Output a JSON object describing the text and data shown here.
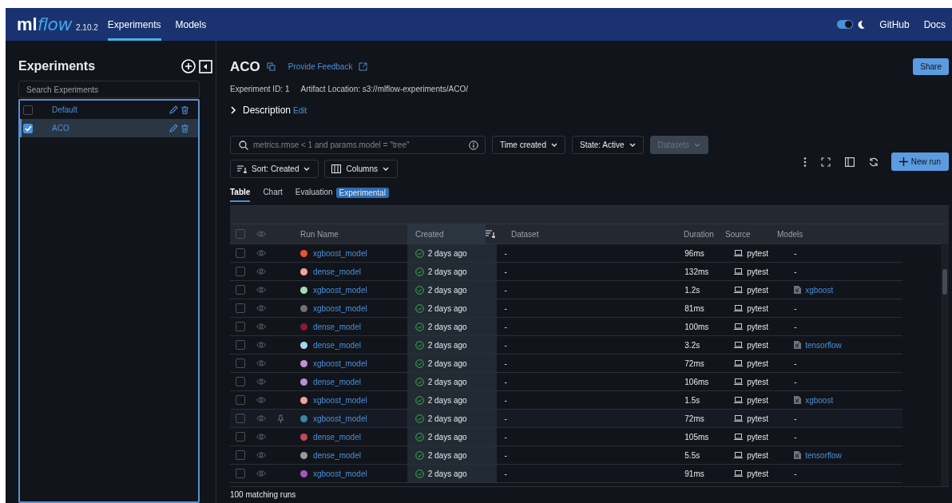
{
  "header": {
    "logo": {
      "part_1": "ml",
      "part_2": "flow"
    },
    "version": "2.10.2",
    "nav": [
      {
        "label": "Experiments",
        "selected": true
      },
      {
        "label": "Models",
        "selected": false
      }
    ],
    "dark_mode": {
      "on": true
    },
    "links": [
      "GitHub",
      "Docs"
    ]
  },
  "sidebar": {
    "title": "Experiments",
    "search": {
      "placeholder": "Search Experiments"
    },
    "items": [
      {
        "name": "Default",
        "checked": false
      },
      {
        "name": "ACO",
        "checked": true
      }
    ]
  },
  "experiment": {
    "title": "ACO",
    "feedback_link": "Provide Feedback",
    "share_button": "Share",
    "experiment_id": "Experiment ID: 1",
    "artifact_location": "Artifact Location: s3://mlflow-experiments/ACO/",
    "description": {
      "label": "Description",
      "edit": "Edit",
      "expanded": false
    }
  },
  "filters": {
    "search": {
      "placeholder": "metrics.rmse < 1 and params.model = \"tree\""
    },
    "dropdowns": [
      {
        "label": "Time created",
        "disabled": false
      },
      {
        "label": "State: Active",
        "disabled": false
      },
      {
        "label": "Datasets",
        "disabled": true
      }
    ],
    "sort": "Sort: Created",
    "columns": "Columns",
    "new_run": "New run"
  },
  "view_tabs": [
    {
      "label": "Table",
      "selected": true
    },
    {
      "label": "Chart",
      "selected": false
    },
    {
      "label": "Evaluation",
      "selected": false,
      "badge": "Experimental"
    }
  ],
  "table": {
    "select_all": {
      "checked": false
    },
    "columns": [
      "Run Name",
      "Created",
      "Dataset",
      "Duration",
      "Source",
      "Models"
    ],
    "rows": [
      {
        "checked": false,
        "pinned": false,
        "color": "#e8532e",
        "name": "xgboost_model",
        "created": "2 days ago",
        "dataset": "-",
        "duration": "96ms",
        "source": "pytest",
        "model": {
          "kind": "none",
          "text": "-"
        }
      },
      {
        "checked": false,
        "pinned": false,
        "color": "#f2a39a",
        "name": "dense_model",
        "created": "2 days ago",
        "dataset": "-",
        "duration": "132ms",
        "source": "pytest",
        "model": {
          "kind": "none",
          "text": "-"
        }
      },
      {
        "checked": false,
        "pinned": false,
        "color": "#a6dbb0",
        "name": "xgboost_model",
        "created": "2 days ago",
        "dataset": "-",
        "duration": "1.2s",
        "source": "pytest",
        "model": {
          "kind": "logged",
          "text": "xgboost"
        }
      },
      {
        "checked": false,
        "pinned": false,
        "color": "#707070",
        "name": "xgboost_model",
        "created": "2 days ago",
        "dataset": "-",
        "duration": "81ms",
        "source": "pytest",
        "model": {
          "kind": "none",
          "text": "-"
        }
      },
      {
        "checked": false,
        "pinned": false,
        "color": "#8b1a3a",
        "name": "dense_model",
        "created": "2 days ago",
        "dataset": "-",
        "duration": "100ms",
        "source": "pytest",
        "model": {
          "kind": "none",
          "text": "-"
        }
      },
      {
        "checked": false,
        "pinned": false,
        "color": "#a6d5ee",
        "name": "dense_model",
        "created": "2 days ago",
        "dataset": "-",
        "duration": "3.2s",
        "source": "pytest",
        "model": {
          "kind": "logged",
          "text": "tensorflow"
        }
      },
      {
        "checked": false,
        "pinned": false,
        "color": "#c38fd8",
        "name": "xgboost_model",
        "created": "2 days ago",
        "dataset": "-",
        "duration": "72ms",
        "source": "pytest",
        "model": {
          "kind": "none",
          "text": "-"
        }
      },
      {
        "checked": false,
        "pinned": false,
        "color": "#b98ed5",
        "name": "dense_model",
        "created": "2 days ago",
        "dataset": "-",
        "duration": "106ms",
        "source": "pytest",
        "model": {
          "kind": "none",
          "text": "-"
        }
      },
      {
        "checked": false,
        "pinned": false,
        "color": "#f2a39a",
        "name": "xgboost_model",
        "created": "2 days ago",
        "dataset": "-",
        "duration": "1.5s",
        "source": "pytest",
        "model": {
          "kind": "logged",
          "text": "xgboost"
        }
      },
      {
        "checked": false,
        "pinned": true,
        "color": "#3a86a8",
        "name": "xgboost_model",
        "created": "2 days ago",
        "dataset": "-",
        "duration": "72ms",
        "source": "pytest",
        "model": {
          "kind": "none",
          "text": "-"
        }
      },
      {
        "checked": false,
        "pinned": false,
        "color": "#c04a5a",
        "name": "dense_model",
        "created": "2 days ago",
        "dataset": "-",
        "duration": "105ms",
        "source": "pytest",
        "model": {
          "kind": "none",
          "text": "-"
        }
      },
      {
        "checked": false,
        "pinned": false,
        "color": "#9a9a9a",
        "name": "dense_model",
        "created": "2 days ago",
        "dataset": "-",
        "duration": "5.5s",
        "source": "pytest",
        "model": {
          "kind": "logged",
          "text": "tensorflow"
        }
      },
      {
        "checked": false,
        "pinned": false,
        "color": "#a855c0",
        "name": "xgboost_model",
        "created": "2 days ago",
        "dataset": "-",
        "duration": "91ms",
        "source": "pytest",
        "model": {
          "kind": "none",
          "text": "-"
        }
      }
    ],
    "footer": "100 matching runs"
  }
}
